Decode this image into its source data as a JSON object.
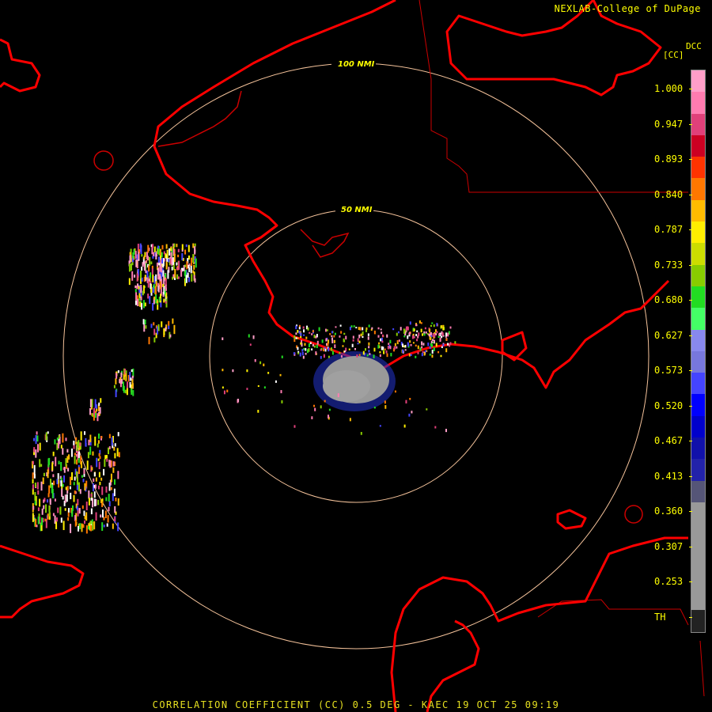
{
  "header": {
    "credit": "NEXLAB-College of DuPage"
  },
  "footer": {
    "title": "CORRELATION COEFFICIENT (CC) 0.5 DEG - KAEC 19 OCT 25 09:19"
  },
  "legend": {
    "product": "DCC",
    "unit": "[CC]",
    "ticks": [
      "1.000",
      "0.947",
      "0.893",
      "0.840",
      "0.787",
      "0.733",
      "0.680",
      "0.627",
      "0.573",
      "0.520",
      "0.467",
      "0.413",
      "0.360",
      "0.307",
      "0.253",
      "TH"
    ],
    "colors": [
      "#ff9ec8",
      "#ff7bb0",
      "#e0407a",
      "#cc0022",
      "#ff3300",
      "#ff7700",
      "#ffbb00",
      "#ffee00",
      "#ccdd00",
      "#88cc00",
      "#22dd22",
      "#44ff66",
      "#8888ee",
      "#7777dd",
      "#4444ff",
      "#0000ff",
      "#0000cc",
      "#1111aa",
      "#2222aa",
      "#555577",
      "#999999",
      "#999999",
      "#999999",
      "#999999",
      "#999999",
      "#222222"
    ]
  },
  "rings": {
    "inner_label": "50 NMI",
    "outer_label": "100 NMI",
    "color": "#f4c29a"
  },
  "colors": {
    "coastline": "#ff0000",
    "border": "#cc0000",
    "text": "#ffff00",
    "echo_core": "#999999",
    "echo_edge": "#2233cc"
  }
}
